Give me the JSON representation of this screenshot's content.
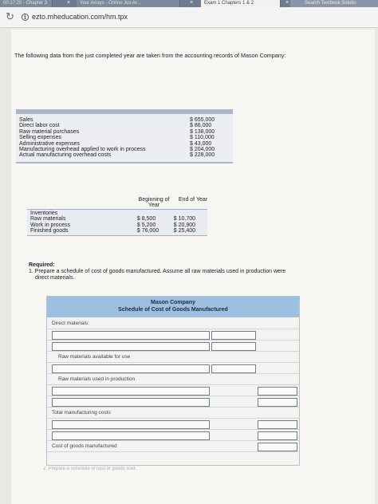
{
  "browser": {
    "tabs": [
      "00:17:20 - Chapter 3",
      "Your Arrays - Online Jus Ar...",
      "Exam 1 Chapters 1 & 2"
    ],
    "search_tab": "Search Textbook Solutio",
    "url": "ezto.mheducation.com/hm.tpx"
  },
  "intro": "The following data from the just completed year are taken from the accounting records of Mason Company:",
  "data_rows": [
    {
      "label": "Sales",
      "amount": "$ 655,000"
    },
    {
      "label": "Direct labor cost",
      "amount": "$  86,000"
    },
    {
      "label": "Raw material purchases",
      "amount": "$ 138,000"
    },
    {
      "label": "Selling expenses",
      "amount": "$ 110,000"
    },
    {
      "label": "Administrative expenses",
      "amount": "$  43,000"
    },
    {
      "label": "Manufacturing overhead applied to work in process",
      "amount": "$ 204,000"
    },
    {
      "label": "Actual manufacturing overhead costs",
      "amount": "$ 228,000"
    }
  ],
  "inventory": {
    "col_beginning": "Beginning of Year",
    "col_end": "End of Year",
    "header_label": "Inventories",
    "rows": [
      {
        "label": "Raw materials",
        "beginning": "$  8,500",
        "end": "$ 10,700"
      },
      {
        "label": "Work in process",
        "beginning": "$  5,200",
        "end": "$ 20,900"
      },
      {
        "label": "Finished goods",
        "beginning": "$ 76,000",
        "end": "$ 25,400"
      }
    ]
  },
  "required": {
    "label": "Required:",
    "q1_line1": "1. Prepare a schedule of cost of goods manufactured. Assume all raw materials used in production were",
    "q1_line2": "direct materials."
  },
  "schedule": {
    "company": "Mason Company",
    "title": "Schedule of Cost of Goods Manufactured",
    "labels": {
      "direct_materials": "Direct materials:",
      "available": "Raw materials available for use",
      "used": "Raw materials used in production",
      "total": "Total manufacturing costs",
      "cogm": "Cost of goods manufactured"
    }
  },
  "next_question": "2. Prepare a schedule of cost of goods sold."
}
